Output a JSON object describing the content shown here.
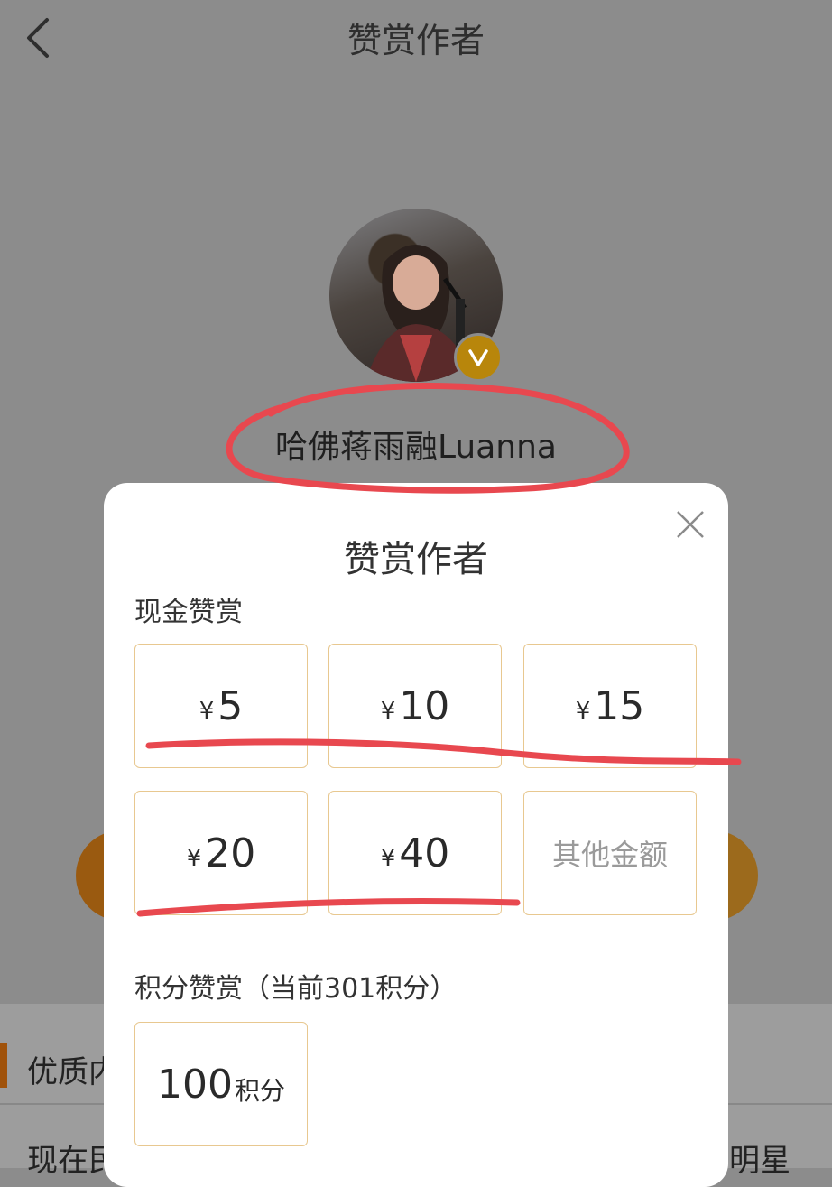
{
  "header": {
    "title": "赞赏作者"
  },
  "author": {
    "name": "哈佛蒋雨融Luanna"
  },
  "modal": {
    "title": "赞赏作者",
    "cash_section_label": "现金赞赏",
    "currency_symbol": "¥",
    "cash_amounts": [
      "5",
      "10",
      "15",
      "20",
      "40"
    ],
    "other_amount_label": "其他金额",
    "points_section_label": "积分赞赏（当前301积分）",
    "points_option": {
      "value": "100",
      "unit": "积分"
    }
  },
  "background_page": {
    "section_text": "优质内",
    "line_text_start": "现在民",
    "line_text_end": "明星"
  },
  "colors": {
    "overlay_gray": "#8c8c8c",
    "modal_bg": "#ffffff",
    "option_border": "#e8c890",
    "verified_badge": "#b8860b",
    "annotation_red": "#e8484f"
  }
}
